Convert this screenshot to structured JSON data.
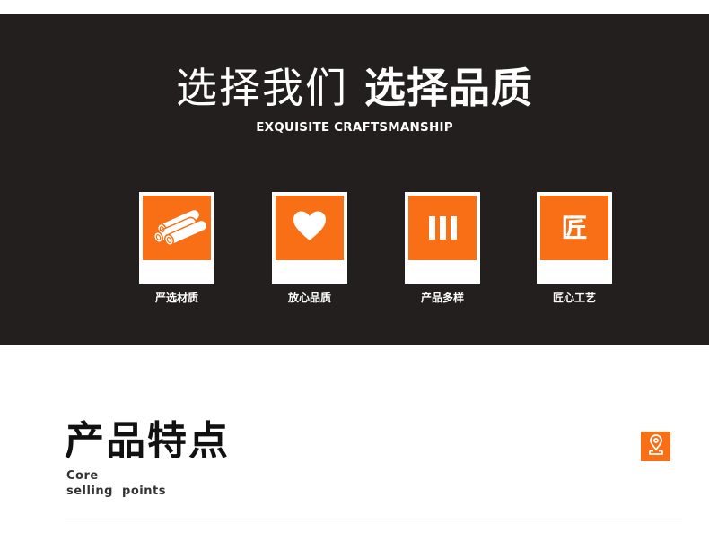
{
  "hero": {
    "title_light": "选择我们",
    "title_bold": "选择品质",
    "subtitle": "EXQUISITE CRAFTSMANSHIP"
  },
  "features": [
    {
      "label": "严选材质",
      "icon": "pipes-icon"
    },
    {
      "label": "放心品质",
      "icon": "heart-icon"
    },
    {
      "label": "产品多样",
      "icon": "bars-icon"
    },
    {
      "label": "匠心工艺",
      "icon": "craftsman-glyph-icon",
      "glyph": "匠"
    }
  ],
  "section": {
    "title": "产品特点",
    "subtitle_line1": "Core",
    "subtitle_line2": "selling  points",
    "icon": "location-pin-icon"
  },
  "colors": {
    "accent": "#f86f15",
    "dark_background": "#231f1e",
    "text_light": "#ffffff",
    "divider": "#b7b7b7"
  }
}
